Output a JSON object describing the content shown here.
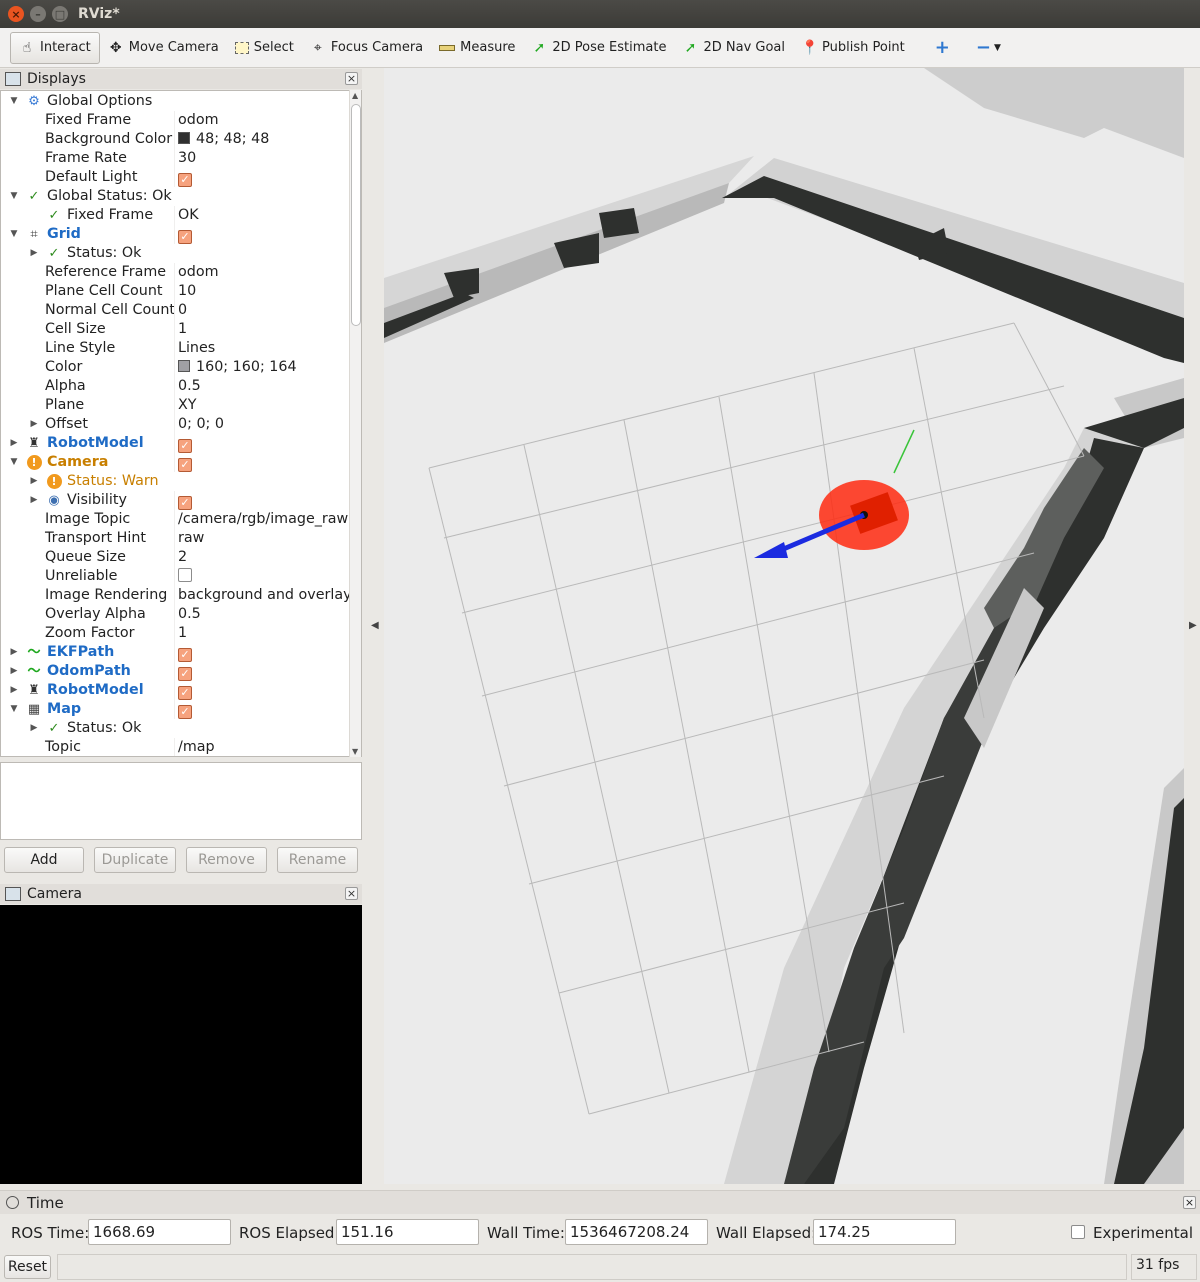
{
  "window": {
    "title": "RViz*"
  },
  "toolbar": {
    "tools": [
      {
        "label": "Interact",
        "icon": "hand-icon"
      },
      {
        "label": "Move Camera",
        "icon": "move-camera-icon"
      },
      {
        "label": "Select",
        "icon": "select-icon"
      },
      {
        "label": "Focus Camera",
        "icon": "focus-camera-icon"
      },
      {
        "label": "Measure",
        "icon": "ruler-icon"
      },
      {
        "label": "2D Pose Estimate",
        "icon": "green-arrow-icon"
      },
      {
        "label": "2D Nav Goal",
        "icon": "green-arrow-icon"
      },
      {
        "label": "Publish Point",
        "icon": "map-pin-icon"
      }
    ],
    "add_symbol": "+",
    "remove_symbol": "−"
  },
  "displays_panel": {
    "title": "Displays",
    "rows": [
      {
        "label": "Global Options",
        "value": ""
      },
      {
        "label": "Fixed Frame",
        "value": "odom"
      },
      {
        "label": "Background Color",
        "value": "48; 48; 48"
      },
      {
        "label": "Frame Rate",
        "value": "30"
      },
      {
        "label": "Default Light",
        "value": ""
      },
      {
        "label": "Global Status: Ok",
        "value": ""
      },
      {
        "label": "Fixed Frame",
        "value": "OK"
      },
      {
        "label": "Grid",
        "value": ""
      },
      {
        "label": "Status: Ok",
        "value": ""
      },
      {
        "label": "Reference Frame",
        "value": "odom"
      },
      {
        "label": "Plane Cell Count",
        "value": "10"
      },
      {
        "label": "Normal Cell Count",
        "value": "0"
      },
      {
        "label": "Cell Size",
        "value": "1"
      },
      {
        "label": "Line Style",
        "value": "Lines"
      },
      {
        "label": "Color",
        "value": "160; 160; 164"
      },
      {
        "label": "Alpha",
        "value": "0.5"
      },
      {
        "label": "Plane",
        "value": "XY"
      },
      {
        "label": "Offset",
        "value": "0; 0; 0"
      },
      {
        "label": "RobotModel",
        "value": ""
      },
      {
        "label": "Camera",
        "value": ""
      },
      {
        "label": "Status: Warn",
        "value": ""
      },
      {
        "label": "Visibility",
        "value": ""
      },
      {
        "label": "Image Topic",
        "value": "/camera/rgb/image_raw"
      },
      {
        "label": "Transport Hint",
        "value": "raw"
      },
      {
        "label": "Queue Size",
        "value": "2"
      },
      {
        "label": "Unreliable",
        "value": ""
      },
      {
        "label": "Image Rendering",
        "value": "background and overlay"
      },
      {
        "label": "Overlay Alpha",
        "value": "0.5"
      },
      {
        "label": "Zoom Factor",
        "value": "1"
      },
      {
        "label": "EKFPath",
        "value": ""
      },
      {
        "label": "OdomPath",
        "value": ""
      },
      {
        "label": "RobotModel",
        "value": ""
      },
      {
        "label": "Map",
        "value": ""
      },
      {
        "label": "Status: Ok",
        "value": ""
      },
      {
        "label": "Topic",
        "value": "/map"
      }
    ],
    "colors": {
      "background_color": "#303030",
      "grid_color": "#a0a0a4"
    },
    "buttons": {
      "add": "Add",
      "duplicate": "Duplicate",
      "remove": "Remove",
      "rename": "Rename"
    }
  },
  "camera_panel": {
    "title": "Camera"
  },
  "time_panel": {
    "title": "Time",
    "ros_time_label": "ROS Time:",
    "ros_time": "1668.69",
    "ros_elapsed_label": "ROS Elapsed:",
    "ros_elapsed": "151.16",
    "wall_time_label": "Wall Time:",
    "wall_time": "1536467208.24",
    "wall_elapsed_label": "Wall Elapsed:",
    "wall_elapsed": "174.25",
    "experimental_label": "Experimental"
  },
  "status_bar": {
    "reset_label": "Reset",
    "fps": "31 fps"
  }
}
